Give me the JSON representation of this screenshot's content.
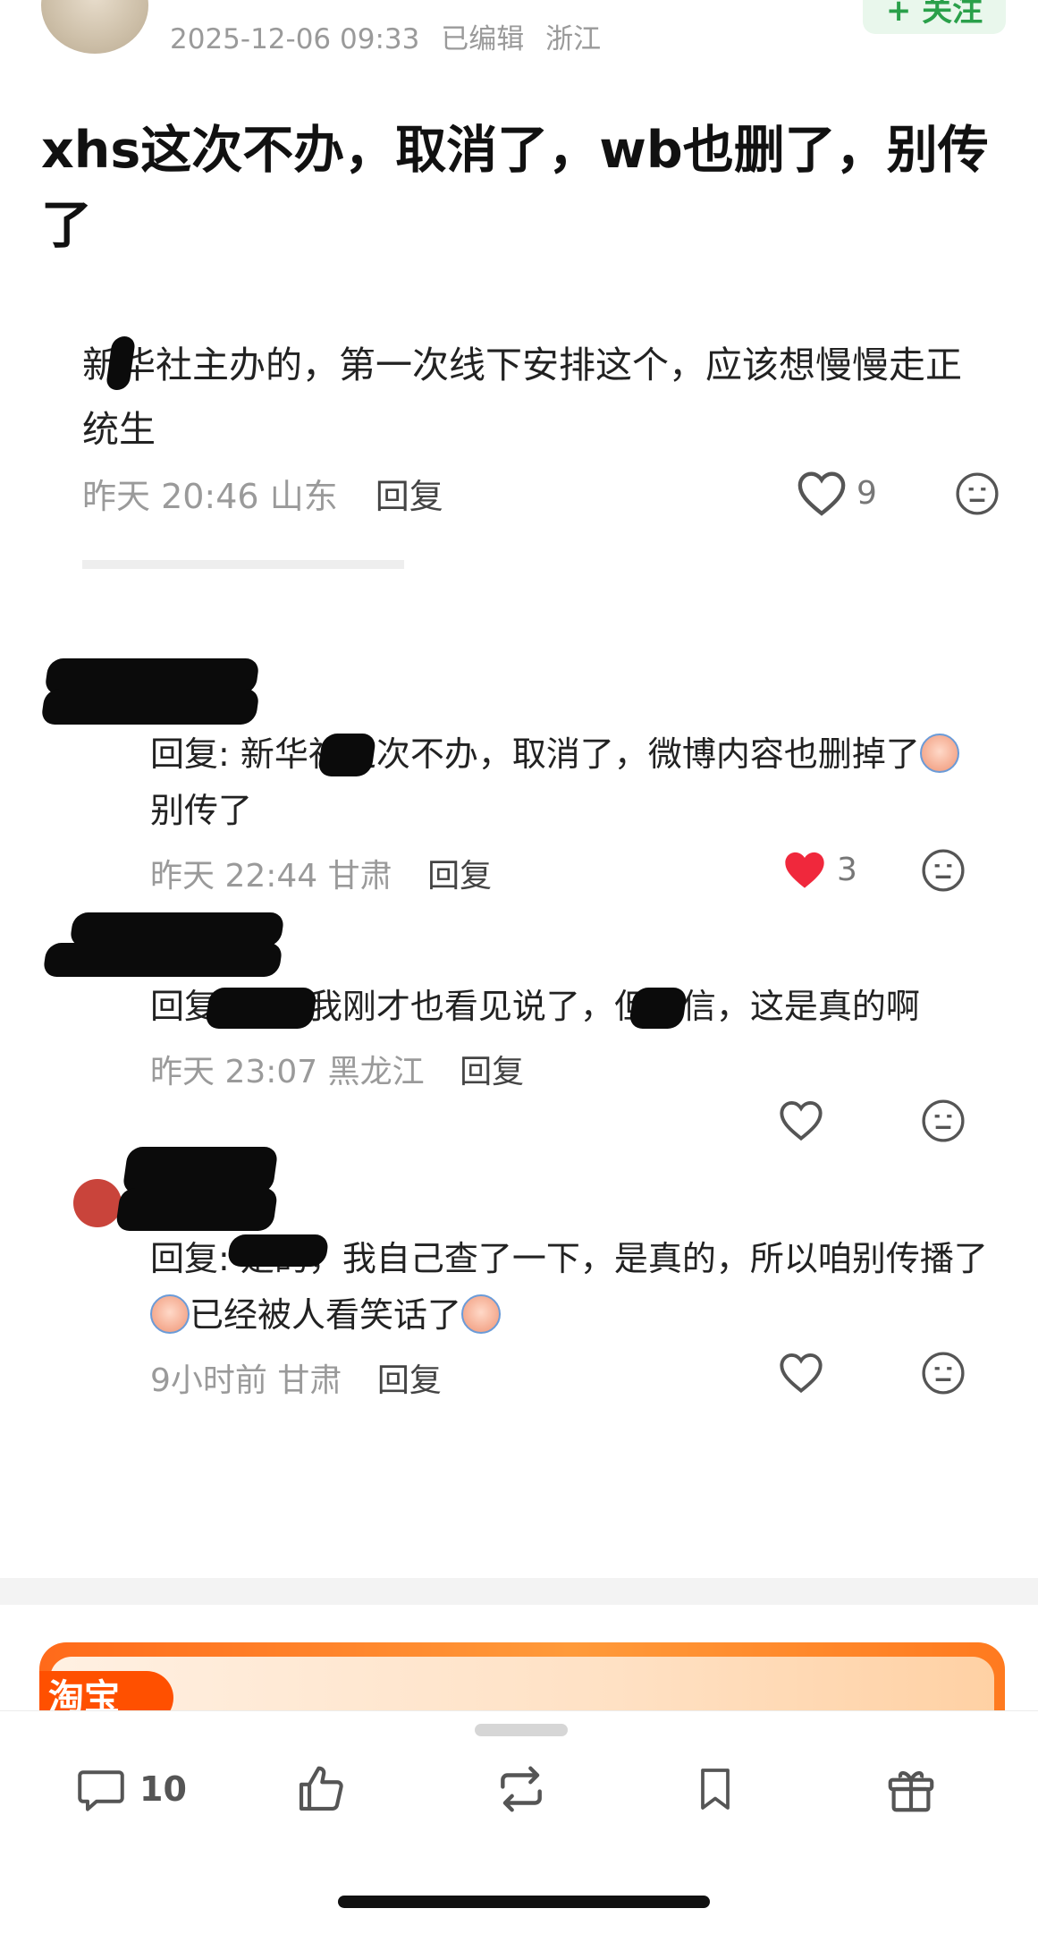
{
  "post": {
    "date": "2025-12-06 09:33",
    "edited_label": "已编辑",
    "location": "浙江",
    "follow_label": "+ 关注",
    "title": "xhs这次不办，取消了，wb也删了，别传了"
  },
  "quoted_comment": {
    "text": "新华社主办的，第一次线下安排这个，应该想慢慢走正统生",
    "time": "昨天 20:46",
    "location": "山东",
    "reply_label": "回复",
    "likes": "9"
  },
  "replies": [
    {
      "text_before": "回复",
      "text_main": ": 新华社这次不办，取消了，微博内容也删掉了",
      "text_after": "别传了",
      "time": "昨天 22:44",
      "location": "甘肃",
      "reply_label": "回复",
      "likes": "3",
      "liked": true
    },
    {
      "text_before": "回复",
      "text_main": ": 啊，我刚才也看见",
      "text_after": "说了，但没信，这是真的啊",
      "time": "昨天 23:07",
      "location": "黑龙江",
      "reply_label": "回复",
      "likes": "",
      "liked": false
    },
    {
      "text_before": "回复",
      "text_main": ": 是的，我自己查了一下，是真的，所以咱别传播了",
      "text_mid": "已经被人看笑话了",
      "time": "9小时前",
      "location": "甘肃",
      "reply_label": "回复",
      "likes": "",
      "liked": false
    }
  ],
  "ad": {
    "tag": "淘宝"
  },
  "toolbar": {
    "comment_count": "10"
  },
  "colors": {
    "follow_green": "#2aa04a",
    "like_red": "#f0283c",
    "ad_orange": "#ff5000"
  },
  "icons": [
    "comment-icon",
    "thumbs-up-icon",
    "repost-icon",
    "bookmark-icon",
    "gift-icon",
    "heart-icon",
    "emoji-icon"
  ]
}
